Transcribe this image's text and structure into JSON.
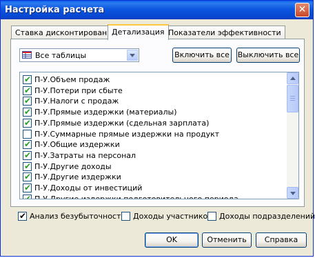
{
  "window": {
    "title": "Настройка расчета",
    "close_glyph": "✕"
  },
  "tabs": [
    {
      "label": "Ставка дисконтирования",
      "active": false
    },
    {
      "label": "Детализация",
      "active": true
    },
    {
      "label": "Показатели эффективности",
      "active": false
    }
  ],
  "filter": {
    "selected": "Все таблицы",
    "icon": "tables-icon"
  },
  "toolbar": {
    "enable_all": "Включить все",
    "disable_all": "Выключить все"
  },
  "list": {
    "items": [
      {
        "label": "П-У.Объем продаж",
        "checked": true
      },
      {
        "label": "П-У.Потери при сбыте",
        "checked": true
      },
      {
        "label": "П-У.Налоги с продаж",
        "checked": true
      },
      {
        "label": "П-У.Прямые издержки (материалы)",
        "checked": true
      },
      {
        "label": "П-У.Прямые издержки (сдельная зарплата)",
        "checked": true
      },
      {
        "label": "П-У.Суммарные прямые издержки на продукт",
        "checked": false
      },
      {
        "label": "П-У.Общие издержки",
        "checked": true
      },
      {
        "label": "П-У.Затраты на персонал",
        "checked": true
      },
      {
        "label": "П-У.Другие доходы",
        "checked": true
      },
      {
        "label": "П-У.Другие издержки",
        "checked": true
      },
      {
        "label": "П-У.Доходы от инвестиций",
        "checked": true
      },
      {
        "label": "П-У.Другие издержки подготовительного периода",
        "checked": true
      }
    ]
  },
  "options": [
    {
      "label": "Анализ безубыточности",
      "checked": true
    },
    {
      "label": "Доходы участников",
      "checked": false
    },
    {
      "label": "Доходы подразделений",
      "checked": false
    }
  ],
  "buttons": {
    "ok": "OK",
    "cancel": "Отменить",
    "help": "Справка"
  },
  "colors": {
    "titlebar": "#0a5ee8",
    "check_green": "#21a121",
    "face": "#ece9d8"
  }
}
